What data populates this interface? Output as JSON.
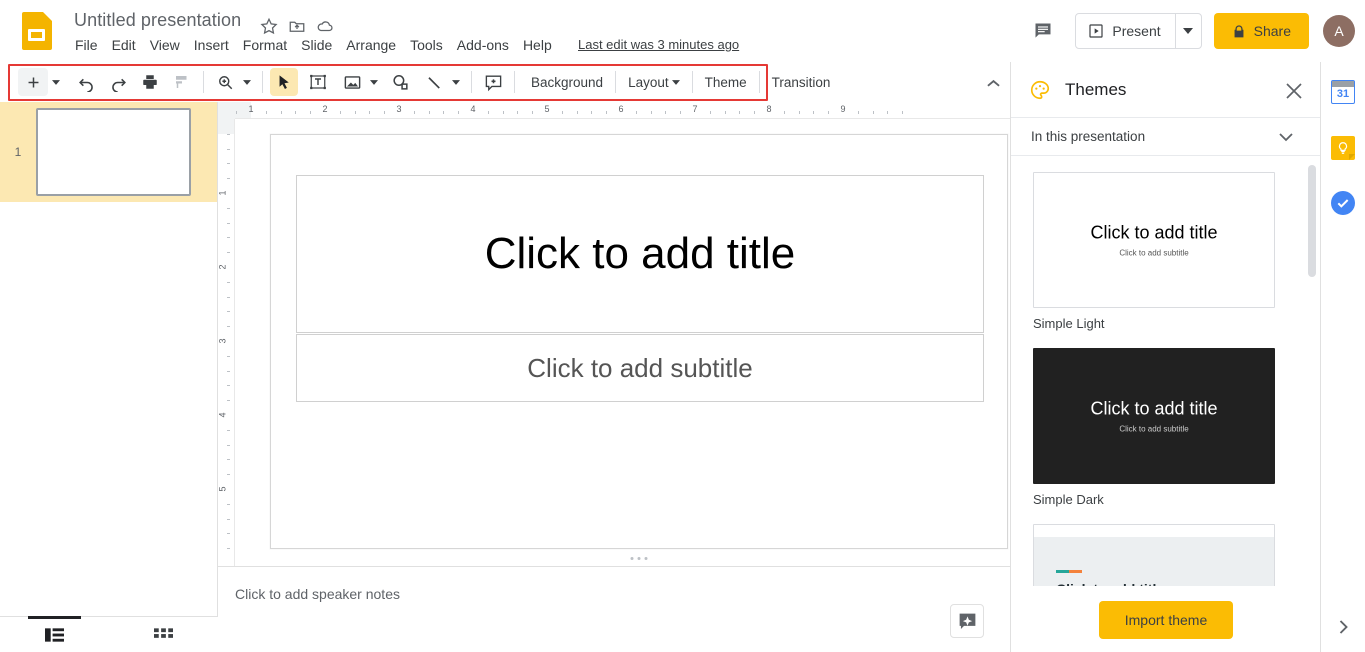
{
  "app": {
    "logo_icon": "google-slides-logo",
    "doc_title": "Untitled presentation",
    "star_icon": "star-icon",
    "move_icon": "move-to-folder-icon",
    "cloud_icon": "cloud-saved-icon",
    "last_edit": "Last edit was 3 minutes ago"
  },
  "menubar": {
    "items": [
      {
        "label": "File"
      },
      {
        "label": "Edit"
      },
      {
        "label": "View"
      },
      {
        "label": "Insert"
      },
      {
        "label": "Format"
      },
      {
        "label": "Slide"
      },
      {
        "label": "Arrange"
      },
      {
        "label": "Tools"
      },
      {
        "label": "Add-ons"
      },
      {
        "label": "Help"
      }
    ]
  },
  "top_right": {
    "comment_icon": "comment-history-icon",
    "present_label": "Present",
    "present_icon": "present-play-icon",
    "present_dropdown_icon": "chevron-down-icon",
    "share_label": "Share",
    "share_icon": "lock-icon",
    "avatar_initial": "A",
    "avatar_color": "#8d6e63",
    "share_color": "#FBBC04"
  },
  "toolbar": {
    "highlight_color": "#e53935",
    "new_slide_icon": "plus-icon",
    "new_slide_caret_icon": "chevron-down-icon",
    "undo_icon": "undo-icon",
    "redo_icon": "redo-icon",
    "print_icon": "print-icon",
    "paint_format_icon": "paint-format-icon",
    "zoom_icon": "zoom-in-icon",
    "zoom_caret_icon": "chevron-down-icon",
    "select_icon": "cursor-select-icon",
    "textbox_icon": "text-box-icon",
    "image_icon": "insert-image-icon",
    "image_caret_icon": "chevron-down-icon",
    "shape_icon": "insert-shape-icon",
    "line_icon": "insert-line-icon",
    "line_caret_icon": "chevron-down-icon",
    "comment_add_icon": "add-comment-icon",
    "background_label": "Background",
    "layout_label": "Layout",
    "layout_caret_icon": "chevron-down-icon",
    "theme_label": "Theme",
    "transition_label": "Transition",
    "collapse_icon": "chevron-up-icon"
  },
  "filmstrip": {
    "slides": [
      {
        "number": "1"
      }
    ]
  },
  "rulers": {
    "horizontal_numbers": [
      "1",
      "2",
      "3",
      "4",
      "5",
      "6",
      "7",
      "8",
      "9"
    ],
    "vertical_numbers": [
      "1",
      "2",
      "3",
      "4",
      "5"
    ]
  },
  "slide": {
    "title_placeholder": "Click to add title",
    "subtitle_placeholder": "Click to add subtitle"
  },
  "notes": {
    "placeholder": "Click to add speaker notes",
    "explore_icon": "explore-icon"
  },
  "view_switch": {
    "filmstrip_icon": "filmstrip-view-icon",
    "grid_icon": "grid-view-icon"
  },
  "themes_panel": {
    "icon": "palette-icon",
    "title": "Themes",
    "close_icon": "close-icon",
    "section_label": "In this presentation",
    "section_chevron_icon": "chevron-down-icon",
    "themes": [
      {
        "name": "Simple Light",
        "title": "Click to add title",
        "subtitle": "Click to add subtitle",
        "style": "light"
      },
      {
        "name": "Simple Dark",
        "title": "Click to add title",
        "subtitle": "Click to add subtitle",
        "style": "dark"
      },
      {
        "name": "",
        "title": "Click to add title",
        "subtitle": "",
        "style": "streamline"
      }
    ],
    "import_label": "Import theme",
    "import_color": "#FBBC04",
    "scrollbar": "panel-scrollbar"
  },
  "right_rail": {
    "calendar_icon": "google-calendar-icon",
    "calendar_day": "31",
    "keep_icon": "google-keep-icon",
    "tasks_icon": "google-tasks-icon",
    "expand_icon": "chevron-right-icon"
  }
}
